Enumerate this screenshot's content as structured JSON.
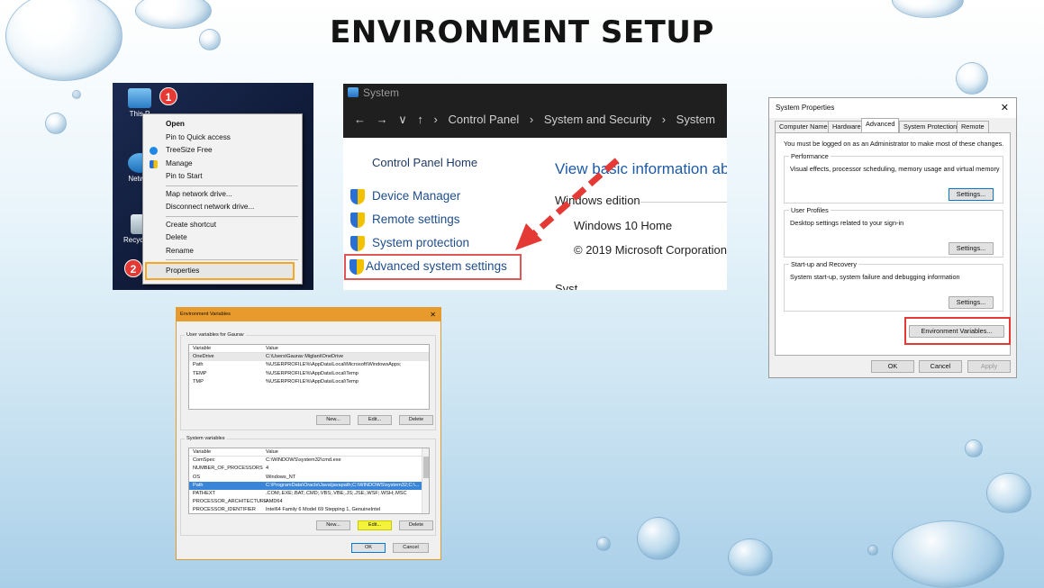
{
  "slide": {
    "title": "ENVIRONMENT SETUP"
  },
  "desktop": {
    "icons": [
      "This P",
      "Networ",
      "Recycle B"
    ],
    "badges": [
      "1",
      "2"
    ],
    "context_menu": [
      "Open",
      "Pin to Quick access",
      "TreeSize Free",
      "Manage",
      "Pin to Start",
      "Map network drive...",
      "Disconnect network drive...",
      "Create shortcut",
      "Delete",
      "Rename",
      "Properties"
    ]
  },
  "system_window": {
    "title": "System",
    "nav": [
      "←",
      "→",
      "∨",
      "↑",
      "›",
      "Control Panel",
      "›",
      "System and Security",
      "›",
      "System"
    ],
    "home": "Control Panel Home",
    "links": [
      "Device Manager",
      "Remote settings",
      "System protection",
      "Advanced system settings"
    ],
    "heading": "View basic information ab",
    "edition_label": "Windows edition",
    "edition": "Windows 10 Home",
    "copyright": "© 2019 Microsoft Corporation",
    "cut_text": "Syst"
  },
  "system_properties": {
    "title": "System Properties",
    "close": "✕",
    "tabs": [
      "Computer Name",
      "Hardware",
      "Advanced",
      "System Protection",
      "Remote"
    ],
    "note": "You must be logged on as an Administrator to make most of these changes.",
    "performance": {
      "title": "Performance",
      "desc": "Visual effects, processor scheduling, memory usage and virtual memory",
      "button": "Settings..."
    },
    "user_profiles": {
      "title": "User Profiles",
      "desc": "Desktop settings related to your sign-in",
      "button": "Settings..."
    },
    "startup": {
      "title": "Start-up and Recovery",
      "desc": "System start-up, system failure and debugging information",
      "button": "Settings..."
    },
    "env_button": "Environment Variables...",
    "ok": "OK",
    "cancel": "Cancel",
    "apply": "Apply"
  },
  "env_vars": {
    "title": "Environment Variables",
    "close": "✕",
    "user_section": "User variables for Gaurav",
    "headers": [
      "Variable",
      "Value"
    ],
    "user_rows": [
      [
        "OneDrive",
        "C:\\Users\\Gaurav Miglani\\OneDrive"
      ],
      [
        "Path",
        "%USERPROFILE%\\AppData\\Local\\Microsoft\\WindowsApps;"
      ],
      [
        "TEMP",
        "%USERPROFILE%\\AppData\\Local\\Temp"
      ],
      [
        "TMP",
        "%USERPROFILE%\\AppData\\Local\\Temp"
      ]
    ],
    "user_buttons": [
      "New...",
      "Edit...",
      "Delete"
    ],
    "system_section": "System variables",
    "system_rows": [
      [
        "ComSpec",
        "C:\\WINDOWS\\system32\\cmd.exe"
      ],
      [
        "NUMBER_OF_PROCESSORS",
        "4"
      ],
      [
        "OS",
        "Windows_NT"
      ],
      [
        "Path",
        "C:\\ProgramData\\Oracle\\Java\\javapath;C:\\WINDOWS\\system32;C:\\..."
      ],
      [
        "PATHEXT",
        ".COM;.EXE;.BAT;.CMD;.VBS;.VBE;.JS;.JSE;.WSF;.WSH;.MSC"
      ],
      [
        "PROCESSOR_ARCHITECTURE",
        "AMD64"
      ],
      [
        "PROCESSOR_IDENTIFIER",
        "Intel64 Family 6 Model 69 Stepping 1, GenuineIntel"
      ]
    ],
    "system_buttons": [
      "New...",
      "Edit...",
      "Delete"
    ],
    "ok": "OK",
    "cancel": "Cancel"
  },
  "colors": {
    "highlight_red": "#e53935",
    "highlight_orange": "#f5a623",
    "highlight_yellow": "#f4f33a",
    "selection_blue": "#3a85d8"
  }
}
